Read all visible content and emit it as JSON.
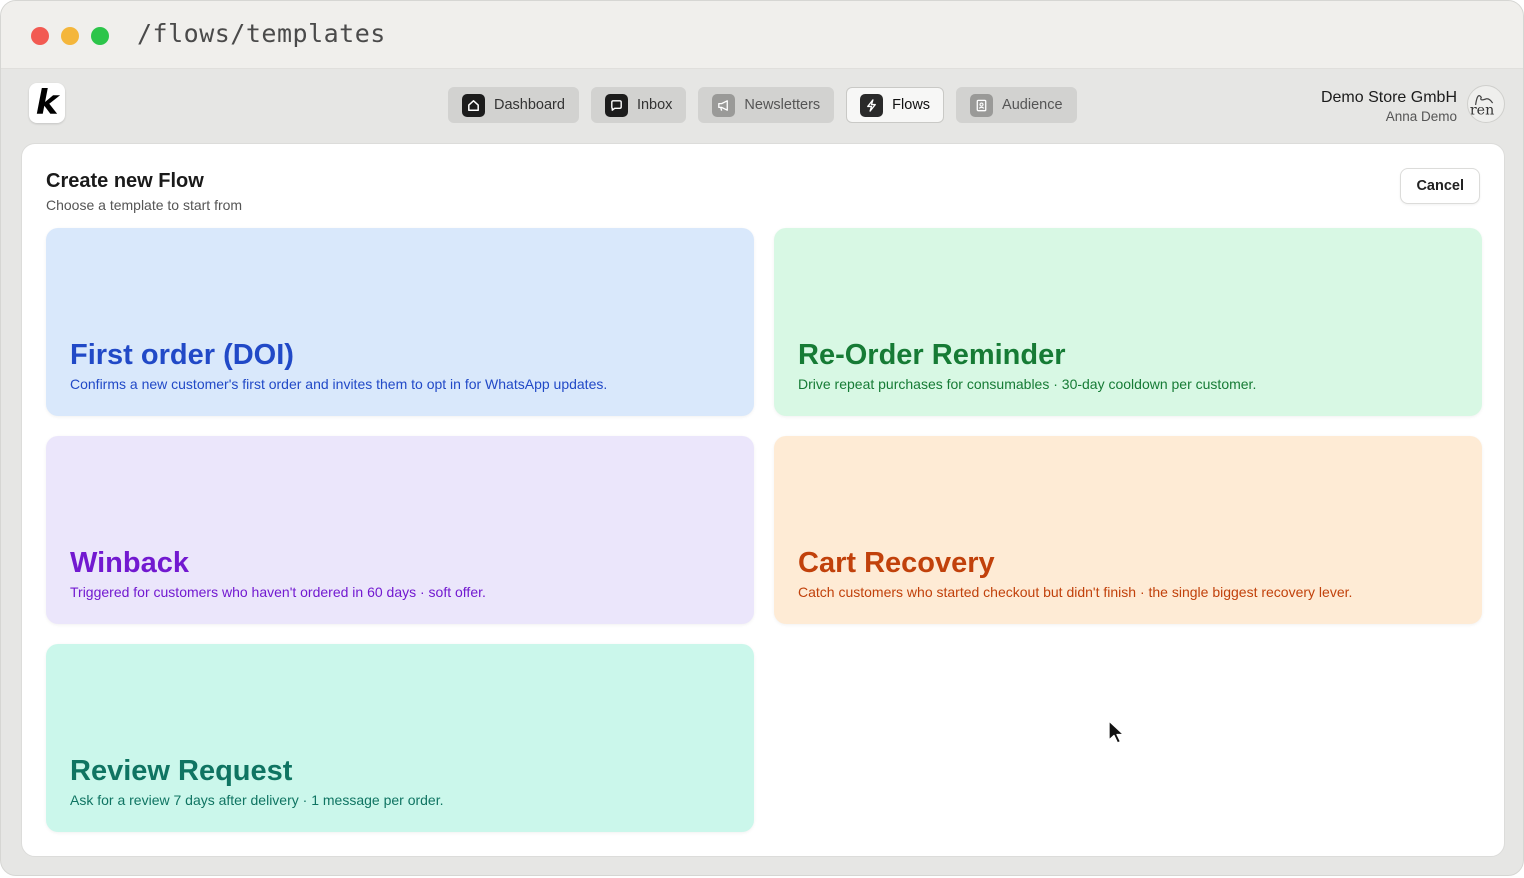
{
  "browser": {
    "url": "/flows/templates"
  },
  "app": {
    "logo_letter": "k",
    "nav": [
      {
        "label": "Dashboard",
        "icon": "home-icon"
      },
      {
        "label": "Inbox",
        "icon": "chat-bubble-icon"
      },
      {
        "label": "Newsletters",
        "icon": "megaphone-icon"
      },
      {
        "label": "Flows",
        "icon": "lightning-icon",
        "active": true
      },
      {
        "label": "Audience",
        "icon": "contacts-icon"
      }
    ],
    "account": {
      "store": "Demo Store GmbH",
      "user": "Anna Demo",
      "avatar_text": "ren"
    }
  },
  "panel": {
    "title": "Create new Flow",
    "subtitle": "Choose a template to start from",
    "cancel_label": "Cancel"
  },
  "templates": [
    {
      "title": "First order (DOI)",
      "description": "Confirms a new customer's first order and invites them to opt in for WhatsApp updates.",
      "color": "#2149c7",
      "background": "#d9e8fb"
    },
    {
      "title": "Re-Order Reminder",
      "description": "Drive repeat purchases for consumables · 30-day cooldown per customer.",
      "color": "#167b35",
      "background": "#d8f8e4"
    },
    {
      "title": "Winback",
      "description": "Triggered for customers who haven't ordered in 60 days · soft offer.",
      "color": "#7219d0",
      "background": "#ebe6fb"
    },
    {
      "title": "Cart Recovery",
      "description": "Catch customers who started checkout but didn't finish · the single biggest recovery lever.",
      "color": "#c1410b",
      "background": "#feebd5"
    },
    {
      "title": "Review Request",
      "description": "Ask for a review 7 days after delivery · 1 message per order.",
      "color": "#0f7462",
      "background": "#cbf7eb"
    }
  ]
}
